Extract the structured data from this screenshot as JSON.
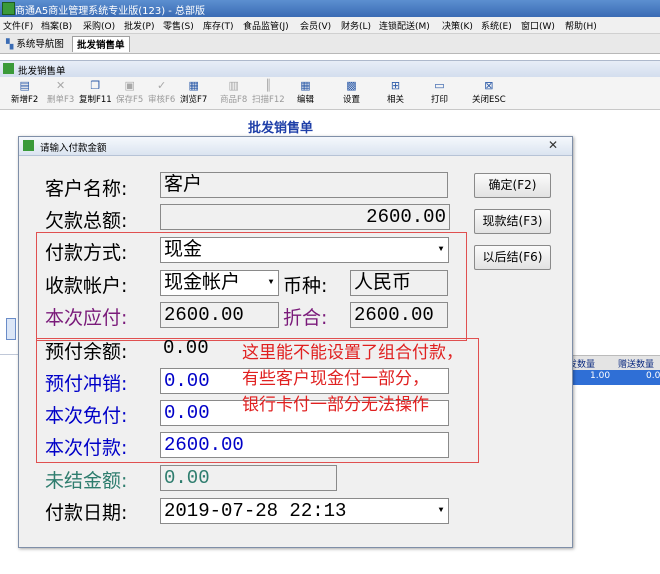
{
  "app": {
    "title": "商通A5商业管理系统专业版(123) - 总部版"
  },
  "menu": [
    "文件(F)",
    "档案(B)",
    "采购(O)",
    "批发(P)",
    "零售(S)",
    "库存(T)",
    "食品监管(J)",
    "会员(V)",
    "财务(L)",
    "连锁配送(M)",
    "决策(K)",
    "系统(E)",
    "窗口(W)",
    "帮助(H)"
  ],
  "tabs": [
    {
      "label": "系统导航图",
      "icon": "sitemap-icon"
    },
    {
      "label": "批发销售单",
      "active": true
    }
  ],
  "window": {
    "title": "批发销售单"
  },
  "toolbar": [
    {
      "label": "新增F2",
      "icon": "new-doc-icon",
      "enabled": true
    },
    {
      "label": "删单F3",
      "icon": "delete-icon",
      "enabled": false
    },
    {
      "label": "复制F11",
      "icon": "copy-icon",
      "enabled": true
    },
    {
      "label": "保存F5",
      "icon": "save-icon",
      "enabled": false
    },
    {
      "label": "审核F6",
      "icon": "approve-icon",
      "enabled": false
    },
    {
      "label": "浏览F7",
      "icon": "browse-icon",
      "enabled": true
    },
    {
      "label": "商品F8",
      "icon": "product-icon",
      "enabled": false
    },
    {
      "label": "扫描F12",
      "icon": "barcode-icon",
      "enabled": false
    },
    {
      "label": "编辑",
      "icon": "edit-icon",
      "enabled": true
    },
    {
      "label": "设置",
      "icon": "settings-icon",
      "enabled": true
    },
    {
      "label": "相关",
      "icon": "related-icon",
      "enabled": true
    },
    {
      "label": "打印",
      "icon": "print-icon",
      "enabled": true
    },
    {
      "label": "关闭ESC",
      "icon": "close-icon",
      "enabled": true
    }
  ],
  "background_form": {
    "title": "批发销售单",
    "grid_headers": [
      "发数量",
      "赠送数量"
    ],
    "grid_row": [
      "1.00",
      "0.0"
    ]
  },
  "dialog": {
    "title": "请输入付款金额",
    "fields": {
      "customer_name": {
        "label": "客户名称:",
        "value": "客户"
      },
      "total_debt": {
        "label": "欠款总额:",
        "value": "2600.00"
      },
      "payment_method": {
        "label": "付款方式:",
        "value": "现金"
      },
      "receiving_account": {
        "label": "收款帐户:",
        "value": "现金帐户"
      },
      "currency": {
        "label": "币种:",
        "value": "人民币"
      },
      "amount_due": {
        "label": "本次应付:",
        "value": "2600.00"
      },
      "converted": {
        "label": "折合:",
        "value": "2600.00"
      },
      "prepaid_balance": {
        "label": "预付余额:",
        "value": "0.00"
      },
      "prepaid_offset": {
        "label": "预付冲销:",
        "value": "0.00"
      },
      "waived": {
        "label": "本次免付:",
        "value": "0.00"
      },
      "amount_paid": {
        "label": "本次付款:",
        "value": "2600.00"
      },
      "unsettled": {
        "label": "未结金额:",
        "value": "0.00"
      },
      "pay_date": {
        "label": "付款日期:",
        "value": "2019-07-28 22:13"
      }
    },
    "buttons": {
      "confirm": "确定(F2)",
      "cash_settle": "现款结(F3)",
      "settle_later": "以后结(F6)"
    }
  },
  "annotation": {
    "lines": [
      "这里能不能设置了组合付款，",
      "有些客户现金付一部分，",
      "银行卡付一部分无法操作"
    ]
  },
  "colors": {
    "label_default": "#000000",
    "label_amount_due": "#7a1a7a",
    "label_blue": "#0000c8",
    "label_unsettled": "#2e7d6e",
    "annotation": "#e02020"
  }
}
